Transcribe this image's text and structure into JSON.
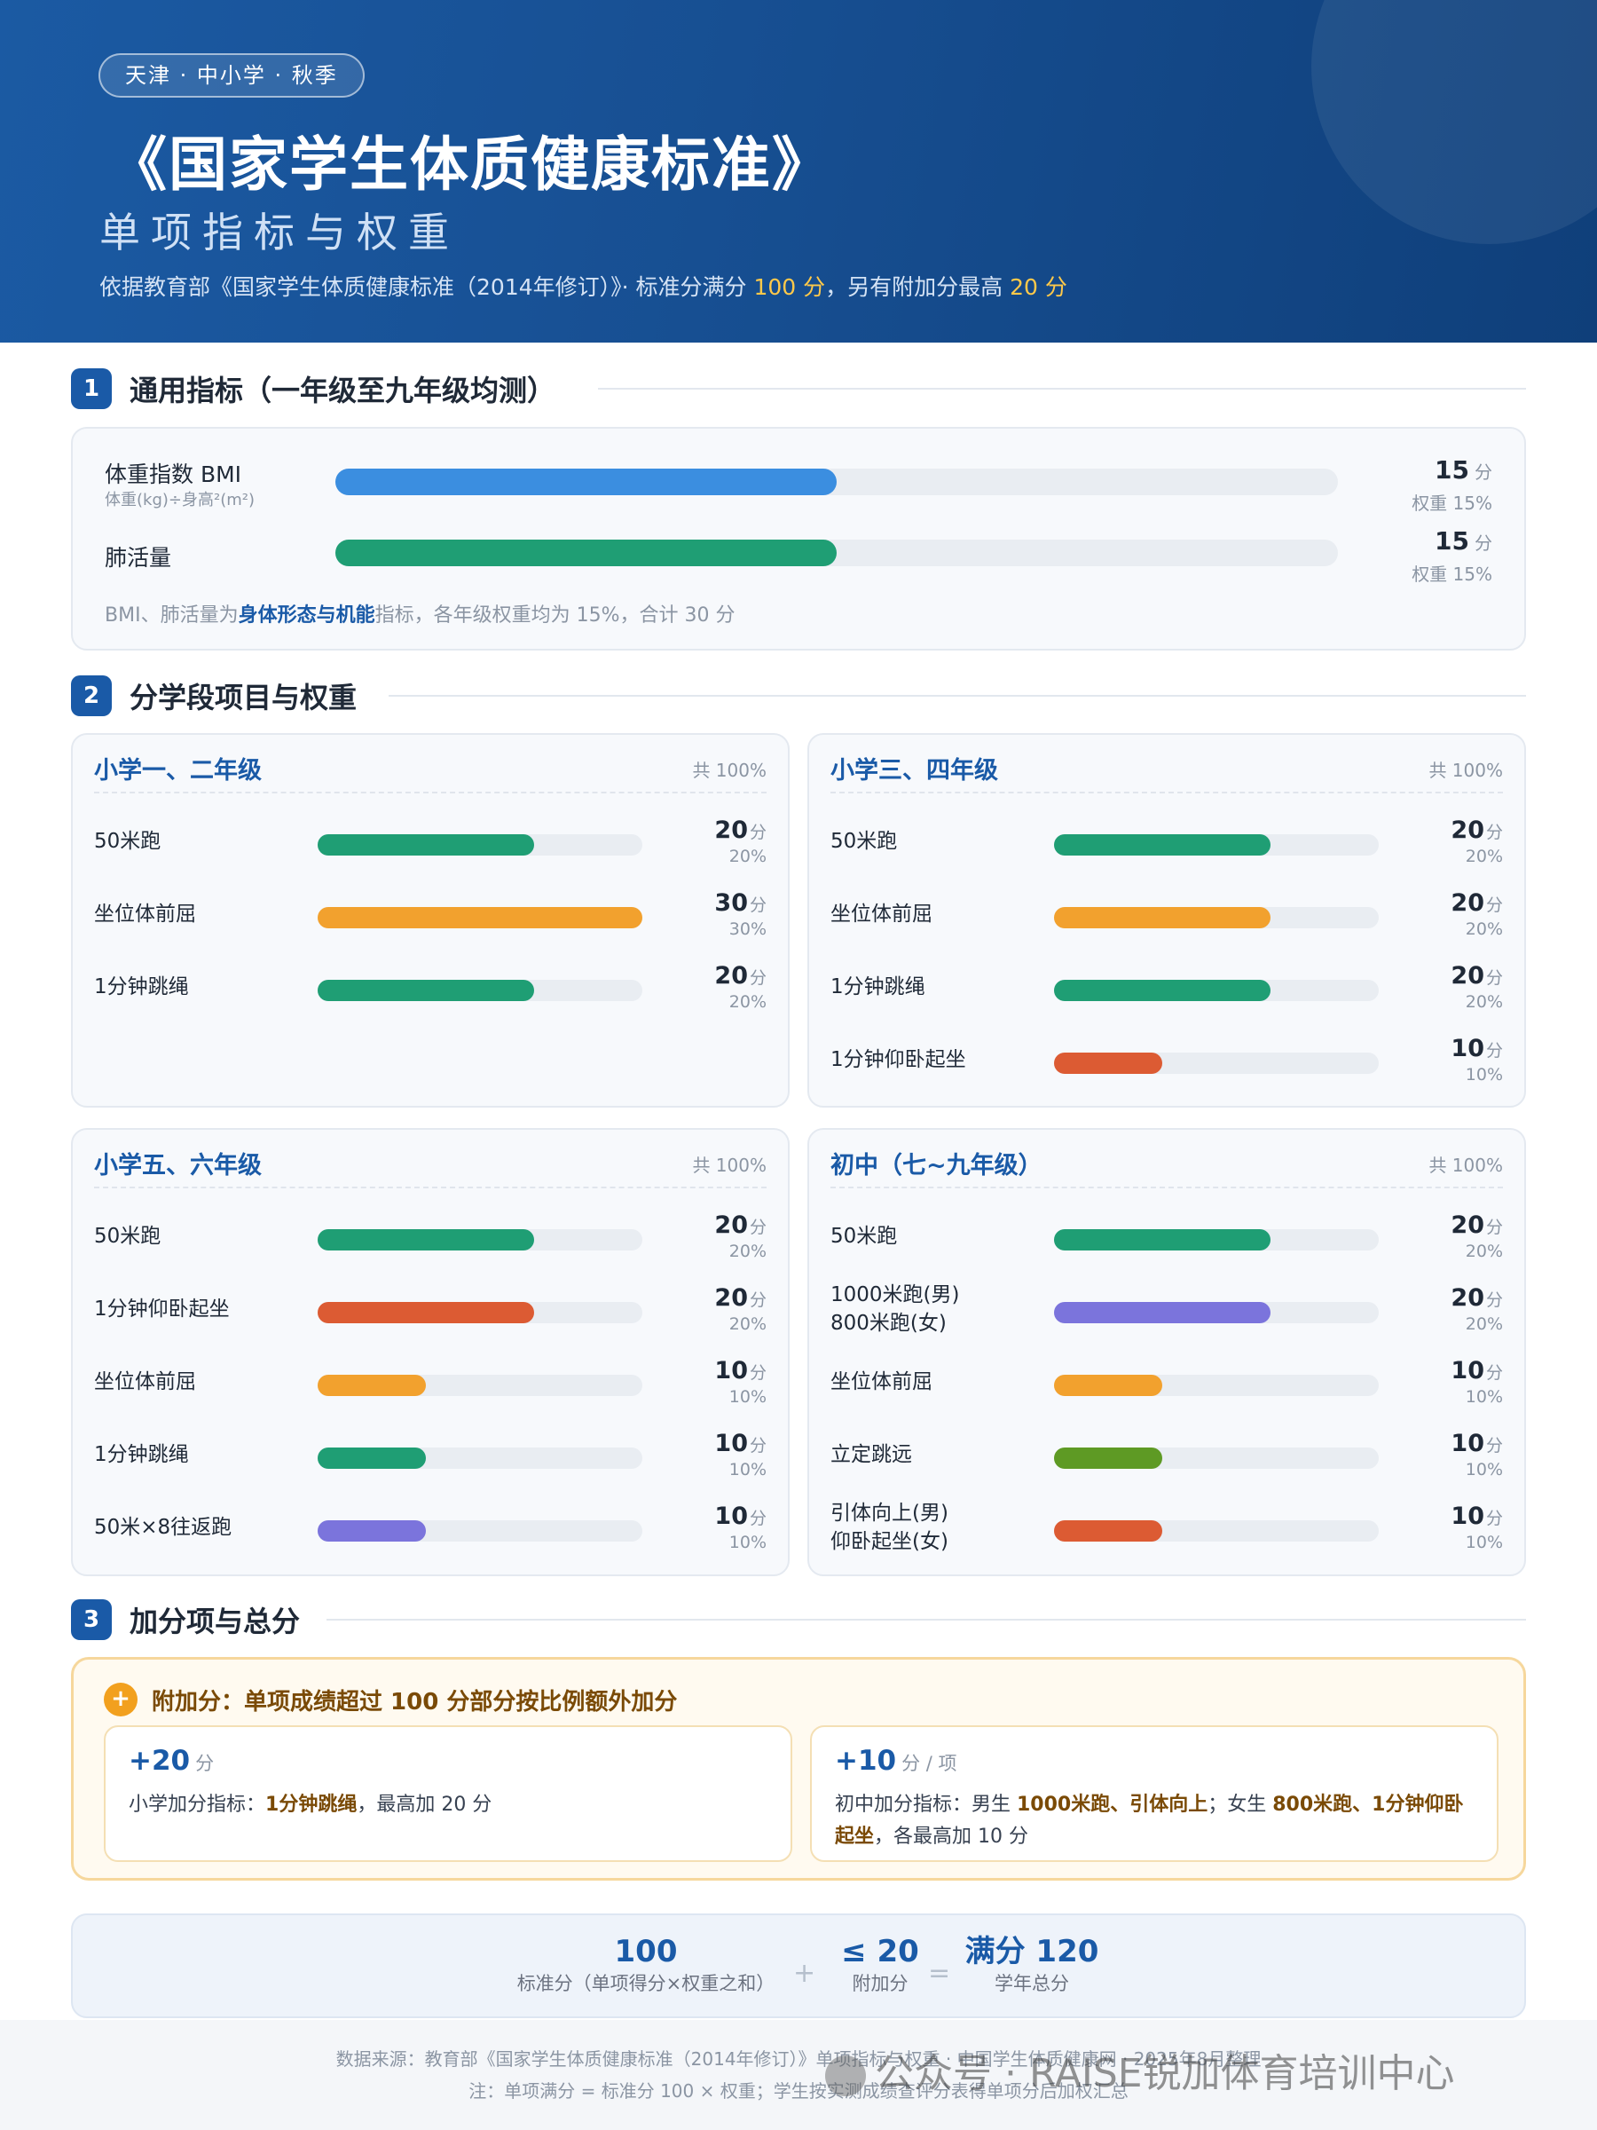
{
  "header": {
    "tag": "天津 · 中小学 · 秋季",
    "title": "《国家学生体质健康标准》",
    "subtitle": "单项指标与权重",
    "desc_pre": "依据教育部《国家学生体质健康标准（2014年修订）》· 标准分满分 ",
    "desc_full": "100 分",
    "desc_mid": "，另有附加分最高 ",
    "desc_bonus": "20 分"
  },
  "sections": {
    "s1": {
      "num": "1",
      "title": "通用指标（一年级至九年级均测）"
    },
    "s2": {
      "num": "2",
      "title": "分学段项目与权重"
    },
    "s3": {
      "num": "3",
      "title": "加分项与总分"
    }
  },
  "general": {
    "items": [
      {
        "label": "体重指数 BMI",
        "sub": "体重(kg)÷身高²(m²)",
        "score": "15",
        "unit": "分",
        "weight": "权重 15%",
        "fraction": 0.5,
        "color": "#3b8ee0"
      },
      {
        "label": "肺活量",
        "sub": "",
        "score": "15",
        "unit": "分",
        "weight": "权重 15%",
        "fraction": 0.5,
        "color": "#1f9e74"
      }
    ],
    "note_pre": "BMI、肺活量为",
    "note_bold": "身体形态与机能",
    "note_post": "指标，各年级权重均为 15%，合计 30 分"
  },
  "grades": [
    {
      "title": "小学一、二年级",
      "total": "共 100%",
      "items": [
        {
          "label": "50米跑",
          "label2": "",
          "score": "20",
          "unit": "分",
          "weight": "20%",
          "fraction": 0.667,
          "color": "#1f9e74"
        },
        {
          "label": "坐位体前屈",
          "label2": "",
          "score": "30",
          "unit": "分",
          "weight": "30%",
          "fraction": 1.0,
          "color": "#f2a12e"
        },
        {
          "label": "1分钟跳绳",
          "label2": "",
          "score": "20",
          "unit": "分",
          "weight": "20%",
          "fraction": 0.667,
          "color": "#1f9e74"
        }
      ]
    },
    {
      "title": "小学三、四年级",
      "total": "共 100%",
      "items": [
        {
          "label": "50米跑",
          "label2": "",
          "score": "20",
          "unit": "分",
          "weight": "20%",
          "fraction": 0.667,
          "color": "#1f9e74"
        },
        {
          "label": "坐位体前屈",
          "label2": "",
          "score": "20",
          "unit": "分",
          "weight": "20%",
          "fraction": 0.667,
          "color": "#f2a12e"
        },
        {
          "label": "1分钟跳绳",
          "label2": "",
          "score": "20",
          "unit": "分",
          "weight": "20%",
          "fraction": 0.667,
          "color": "#1f9e74"
        },
        {
          "label": "1分钟仰卧起坐",
          "label2": "",
          "score": "10",
          "unit": "分",
          "weight": "10%",
          "fraction": 0.333,
          "color": "#dc5b33"
        }
      ]
    },
    {
      "title": "小学五、六年级",
      "total": "共 100%",
      "items": [
        {
          "label": "50米跑",
          "label2": "",
          "score": "20",
          "unit": "分",
          "weight": "20%",
          "fraction": 0.667,
          "color": "#1f9e74"
        },
        {
          "label": "1分钟仰卧起坐",
          "label2": "",
          "score": "20",
          "unit": "分",
          "weight": "20%",
          "fraction": 0.667,
          "color": "#dc5b33"
        },
        {
          "label": "坐位体前屈",
          "label2": "",
          "score": "10",
          "unit": "分",
          "weight": "10%",
          "fraction": 0.333,
          "color": "#f2a12e"
        },
        {
          "label": "1分钟跳绳",
          "label2": "",
          "score": "10",
          "unit": "分",
          "weight": "10%",
          "fraction": 0.333,
          "color": "#1f9e74"
        },
        {
          "label": "50米×8往返跑",
          "label2": "",
          "score": "10",
          "unit": "分",
          "weight": "10%",
          "fraction": 0.333,
          "color": "#7b74dc"
        }
      ]
    },
    {
      "title": "初中（七~九年级）",
      "total": "共 100%",
      "items": [
        {
          "label": "50米跑",
          "label2": "",
          "score": "20",
          "unit": "分",
          "weight": "20%",
          "fraction": 0.667,
          "color": "#1f9e74"
        },
        {
          "label": "1000米跑(男)",
          "label2": "800米跑(女)",
          "score": "20",
          "unit": "分",
          "weight": "20%",
          "fraction": 0.667,
          "color": "#7b74dc"
        },
        {
          "label": "坐位体前屈",
          "label2": "",
          "score": "10",
          "unit": "分",
          "weight": "10%",
          "fraction": 0.333,
          "color": "#f2a12e"
        },
        {
          "label": "立定跳远",
          "label2": "",
          "score": "10",
          "unit": "分",
          "weight": "10%",
          "fraction": 0.333,
          "color": "#5e9a24"
        },
        {
          "label": "引体向上(男)",
          "label2": "仰卧起坐(女)",
          "score": "10",
          "unit": "分",
          "weight": "10%",
          "fraction": 0.333,
          "color": "#dc5b33"
        }
      ]
    }
  ],
  "bonus": {
    "icon": "+",
    "head": "附加分：单项成绩超过 100 分部分按比例额外加分",
    "primary": {
      "value": "+20",
      "unit": "分",
      "pre": "小学加分指标：",
      "bold": "1分钟跳绳",
      "post": "，最高加 20 分"
    },
    "middle": {
      "value": "+10",
      "unit": "分 / 项",
      "pre": "初中加分指标：男生 ",
      "bold1": "1000米跑、引体向上",
      "mid": "；女生 ",
      "bold2": "800米跑、1分钟仰卧起坐",
      "post": "，各最高加 10 分"
    }
  },
  "formula": {
    "a_num": "100",
    "a_cap": "标准分（单项得分×权重之和）",
    "plus": "+",
    "b_num": "≤ 20",
    "b_cap": "附加分",
    "eq": "=",
    "c_num": "满分 120",
    "c_cap": "学年总分"
  },
  "footer": {
    "line1": "数据来源：教育部《国家学生体质健康标准（2014年修订）》单项指标与权重 · 中国学生体质健康网 · 2025年8月整理",
    "line2": "注：单项满分 = 标准分 100 × 权重；学生按实测成绩查评分表得单项分后加权汇总",
    "watermark": "公众号 · RAISE锐加体育培训中心"
  }
}
